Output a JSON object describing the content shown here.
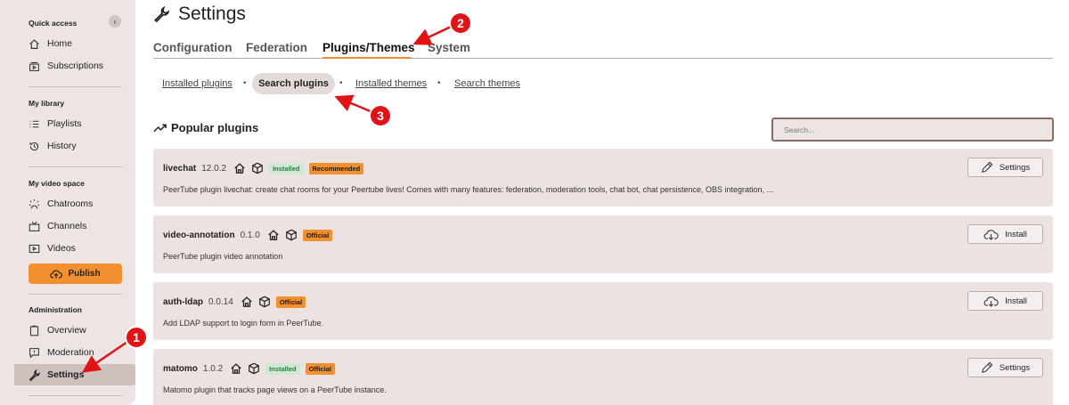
{
  "sidebar": {
    "collapse_glyph": "‹",
    "sections": [
      {
        "title": "Quick access",
        "items": [
          {
            "label": "Home",
            "icon": "home-icon"
          },
          {
            "label": "Subscriptions",
            "icon": "subscriptions-icon"
          }
        ]
      },
      {
        "title": "My library",
        "items": [
          {
            "label": "Playlists",
            "icon": "playlists-icon"
          },
          {
            "label": "History",
            "icon": "history-icon"
          }
        ]
      },
      {
        "title": "My video space",
        "items": [
          {
            "label": "Chatrooms",
            "icon": "chatrooms-icon"
          },
          {
            "label": "Channels",
            "icon": "channels-icon"
          },
          {
            "label": "Videos",
            "icon": "videos-icon"
          }
        ]
      },
      {
        "title": "Administration",
        "items": [
          {
            "label": "Overview",
            "icon": "overview-icon"
          },
          {
            "label": "Moderation",
            "icon": "moderation-icon"
          },
          {
            "label": "Settings",
            "icon": "wrench-icon",
            "active": true
          }
        ]
      }
    ],
    "publish_label": "Publish"
  },
  "page": {
    "title": "Settings",
    "tabs": [
      "Configuration",
      "Federation",
      "Plugins/Themes",
      "System"
    ],
    "active_tab": "Plugins/Themes",
    "subtabs": [
      "Installed plugins",
      "Search plugins",
      "Installed themes",
      "Search themes"
    ],
    "active_subtab": "Search plugins",
    "section_title": "Popular plugins",
    "search_placeholder": "Search..."
  },
  "plugins": [
    {
      "name": "livechat",
      "version": "12.0.2",
      "badges": [
        "Installed",
        "Recommended"
      ],
      "description": "PeerTube plugin livechat: create chat rooms for your Peertube lives! Comes with many features: federation, moderation tools, chat bot, chat persistence, OBS integration, ...",
      "button": "Settings"
    },
    {
      "name": "video-annotation",
      "version": "0.1.0",
      "badges": [
        "Official"
      ],
      "description": "PeerTube plugin video annotation",
      "button": "Install"
    },
    {
      "name": "auth-ldap",
      "version": "0.0.14",
      "badges": [
        "Official"
      ],
      "description": "Add LDAP support to login form in PeerTube.",
      "button": "Install"
    },
    {
      "name": "matomo",
      "version": "1.0.2",
      "badges": [
        "Installed",
        "Official"
      ],
      "description": "Matomo plugin that tracks page views on a PeerTube instance.",
      "button": "Settings"
    }
  ],
  "annotations": [
    "1",
    "2",
    "3"
  ],
  "colors": {
    "accent": "#f2902f",
    "sidebar_bg": "#ede5e3",
    "card_bg": "#ece3e1",
    "callout": "#e01414"
  }
}
